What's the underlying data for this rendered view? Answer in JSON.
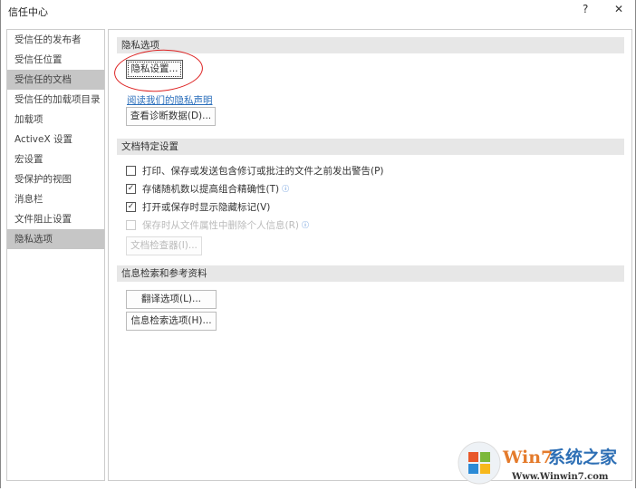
{
  "window": {
    "title": "信任中心",
    "help": "?",
    "close": "✕"
  },
  "nav": {
    "items": [
      "受信任的发布者",
      "受信任位置",
      "受信任的文档",
      "受信任的加载项目录",
      "加载项",
      "ActiveX 设置",
      "宏设置",
      "受保护的视图",
      "消息栏",
      "文件阻止设置",
      "隐私选项"
    ]
  },
  "privacy": {
    "header": "隐私选项",
    "settings_button": "隐私设置...",
    "statement_link": "阅读我们的隐私声明",
    "diagnostics_button": "查看诊断数据(D)..."
  },
  "doc": {
    "header": "文档特定设置",
    "options": [
      {
        "label": "打印、保存或发送包含修订或批注的文件之前发出警告(P)",
        "checked": false
      },
      {
        "label": "存储随机数以提高组合精确性(T)",
        "checked": true
      },
      {
        "label": "打开或保存时显示隐藏标记(V)",
        "checked": true
      },
      {
        "label": "保存时从文件属性中删除个人信息(R)",
        "checked": false
      }
    ],
    "inspector_button": "文档检查器(I)..."
  },
  "research": {
    "header": "信息检索和参考资料",
    "translate_button": "翻译选项(L)...",
    "research_button": "信息检索选项(H)..."
  },
  "watermark": {
    "text": "Win7系统之家",
    "url": "Www.Winwin7.com"
  }
}
